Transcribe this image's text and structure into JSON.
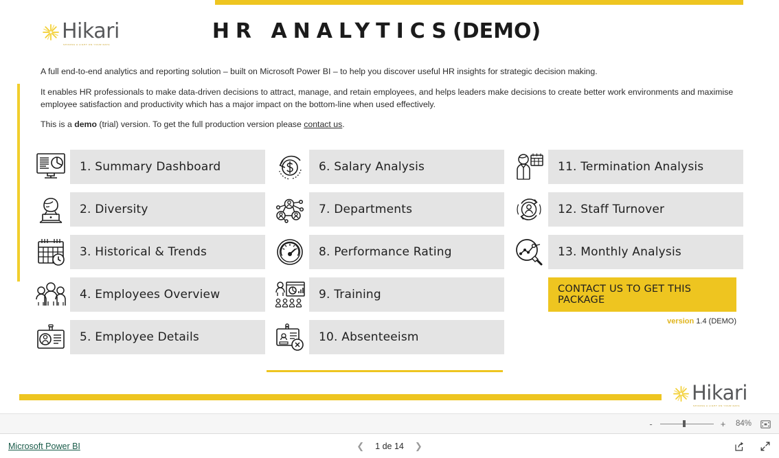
{
  "brand": {
    "name": "Hikari",
    "tagline": "SHINING A LIGHT ON YOUR DATA",
    "logo_icon": "starburst-icon",
    "accent_yellow": "#eec520",
    "logo_text_color": "#58595b",
    "tagline_color": "#c9a227"
  },
  "header": {
    "title_main": "HR ANALYTICS",
    "title_suffix": "(DEMO)"
  },
  "intro": {
    "paragraph_1": "A full end-to-end analytics and reporting solution – built on Microsoft Power BI – to help you discover useful HR insights for strategic decision making.",
    "paragraph_2": "It enables HR professionals to make data-driven decisions to attract, manage, and retain employees, and helps leaders make decisions to create better work environments and maximise employee satisfaction and productivity which has a major impact on the bottom-line when used effectively.",
    "paragraph_3_pre": "This is a ",
    "paragraph_3_bold": "demo",
    "paragraph_3_mid": " (trial) version. To get the full production version please ",
    "paragraph_3_link": "contact us",
    "paragraph_3_post": "."
  },
  "menu": {
    "column_1": [
      {
        "label": "1. Summary Dashboard",
        "icon": "monitor-chart-icon"
      },
      {
        "label": "2. Diversity",
        "icon": "person-laptop-icon"
      },
      {
        "label": "3. Historical & Trends",
        "icon": "calendar-clock-icon"
      },
      {
        "label": "4. Employees Overview",
        "icon": "people-group-icon"
      },
      {
        "label": "5. Employee Details",
        "icon": "id-badge-icon"
      }
    ],
    "column_2": [
      {
        "label": "6. Salary Analysis",
        "icon": "dollar-refresh-icon"
      },
      {
        "label": "7. Departments",
        "icon": "org-network-icon"
      },
      {
        "label": "8. Performance Rating",
        "icon": "gauge-icon"
      },
      {
        "label": "9. Training",
        "icon": "training-presentation-icon"
      },
      {
        "label": "10. Absenteeism",
        "icon": "badge-cancel-icon"
      }
    ],
    "column_3": [
      {
        "label": "11. Termination Analysis",
        "icon": "person-calendar-icon"
      },
      {
        "label": "12. Staff Turnover",
        "icon": "person-cycle-icon"
      },
      {
        "label": "13. Monthly Analysis",
        "icon": "magnifier-chart-icon"
      }
    ]
  },
  "cta": {
    "label": "CONTACT US TO GET THIS PACKAGE",
    "background": "#eec520"
  },
  "version": {
    "label": "version",
    "value": "1.4 (DEMO)"
  },
  "powerbi": {
    "zoom": {
      "minus": "-",
      "plus": "+",
      "percent": "84%",
      "fit_icon": "fit-to-page-icon"
    },
    "status": {
      "brand_link": "Microsoft Power BI",
      "prev_icon": "chevron-left-icon",
      "next_icon": "chevron-right-icon",
      "page_text": "1 de 14",
      "share_icon": "share-icon",
      "fullscreen_icon": "fullscreen-icon"
    }
  }
}
